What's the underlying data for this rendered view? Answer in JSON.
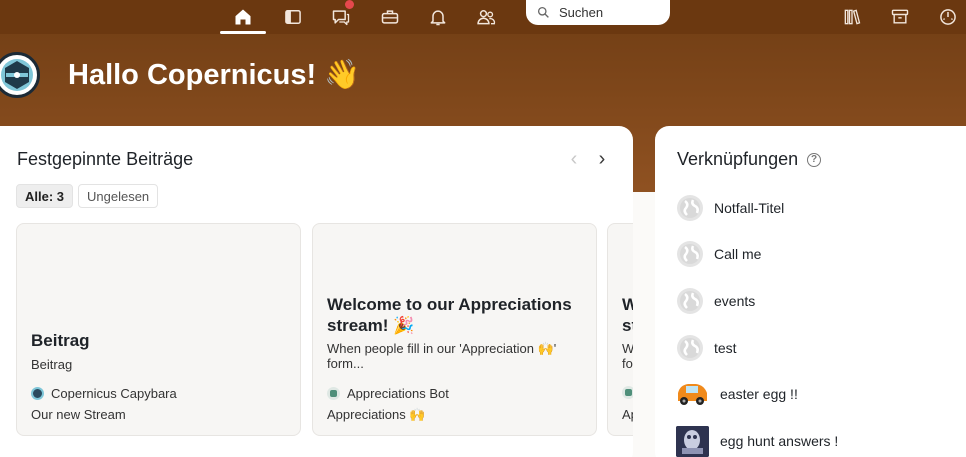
{
  "nav": {
    "items": [
      {
        "name": "home",
        "active": true
      },
      {
        "name": "streams"
      },
      {
        "name": "chat",
        "badge": true
      },
      {
        "name": "toolbox"
      },
      {
        "name": "notifications"
      },
      {
        "name": "people"
      }
    ],
    "search_placeholder": "Suchen"
  },
  "greeting": {
    "text": "Hallo Copernicus! 👋"
  },
  "pinned": {
    "title": "Festgepinnte Beiträge",
    "filter_all": "Alle: 3",
    "filter_unread": "Ungelesen",
    "posts": [
      {
        "title": "Beitrag",
        "description": "Beitrag",
        "author": "Copernicus Capybara",
        "stream": "Our new Stream"
      },
      {
        "title": "Welcome to our Appreciations stream! 🎉",
        "description": "When people fill in our 'Appreciation 🙌' form...",
        "author": "Appreciations Bot",
        "stream": "Appreciations 🙌"
      },
      {
        "title": "W st",
        "description": "W fo",
        "author": "",
        "stream": "Ap"
      }
    ]
  },
  "links": {
    "title": "Verknüpfungen",
    "items": [
      {
        "label": "Notfall-Titel",
        "icon": "globe-icon"
      },
      {
        "label": "Call me",
        "icon": "globe-icon"
      },
      {
        "label": "events",
        "icon": "globe-icon"
      },
      {
        "label": "test",
        "icon": "globe-icon"
      },
      {
        "label": "easter egg !!",
        "icon": "car-icon"
      },
      {
        "label": "egg hunt answers !",
        "icon": "image-thumbnail"
      }
    ]
  },
  "colors": {
    "topbar": "#6b3810",
    "header_gradient_start": "#6f3d14",
    "accent_red": "#e5484d"
  }
}
